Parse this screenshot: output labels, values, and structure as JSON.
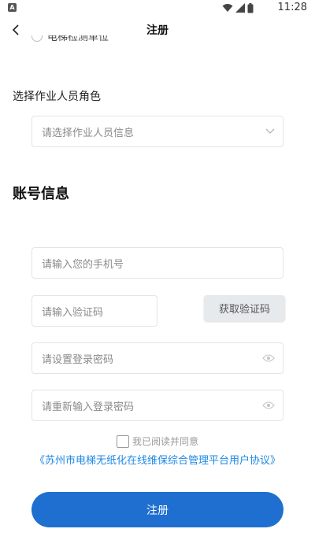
{
  "status_bar": {
    "badge": "A",
    "time": "11:28"
  },
  "nav": {
    "title": "注册"
  },
  "clipped_option": {
    "label": "电梯检测单位"
  },
  "role": {
    "label": "选择作业人员角色",
    "placeholder": "请选择作业人员信息"
  },
  "account": {
    "section_title": "账号信息",
    "phone_placeholder": "请输入您的手机号",
    "code_placeholder": "请输入验证码",
    "get_code_label": "获取验证码",
    "password_placeholder": "请设置登录密码",
    "confirm_placeholder": "请重新输入登录密码"
  },
  "agreement": {
    "checkbox_label": "我已阅读并同意",
    "link_text": "《苏州市电梯无纸化在线维保综合管理平台用户协议》"
  },
  "submit": {
    "label": "注册"
  },
  "colors": {
    "primary": "#1f6fd1",
    "link": "#1e88e5"
  }
}
